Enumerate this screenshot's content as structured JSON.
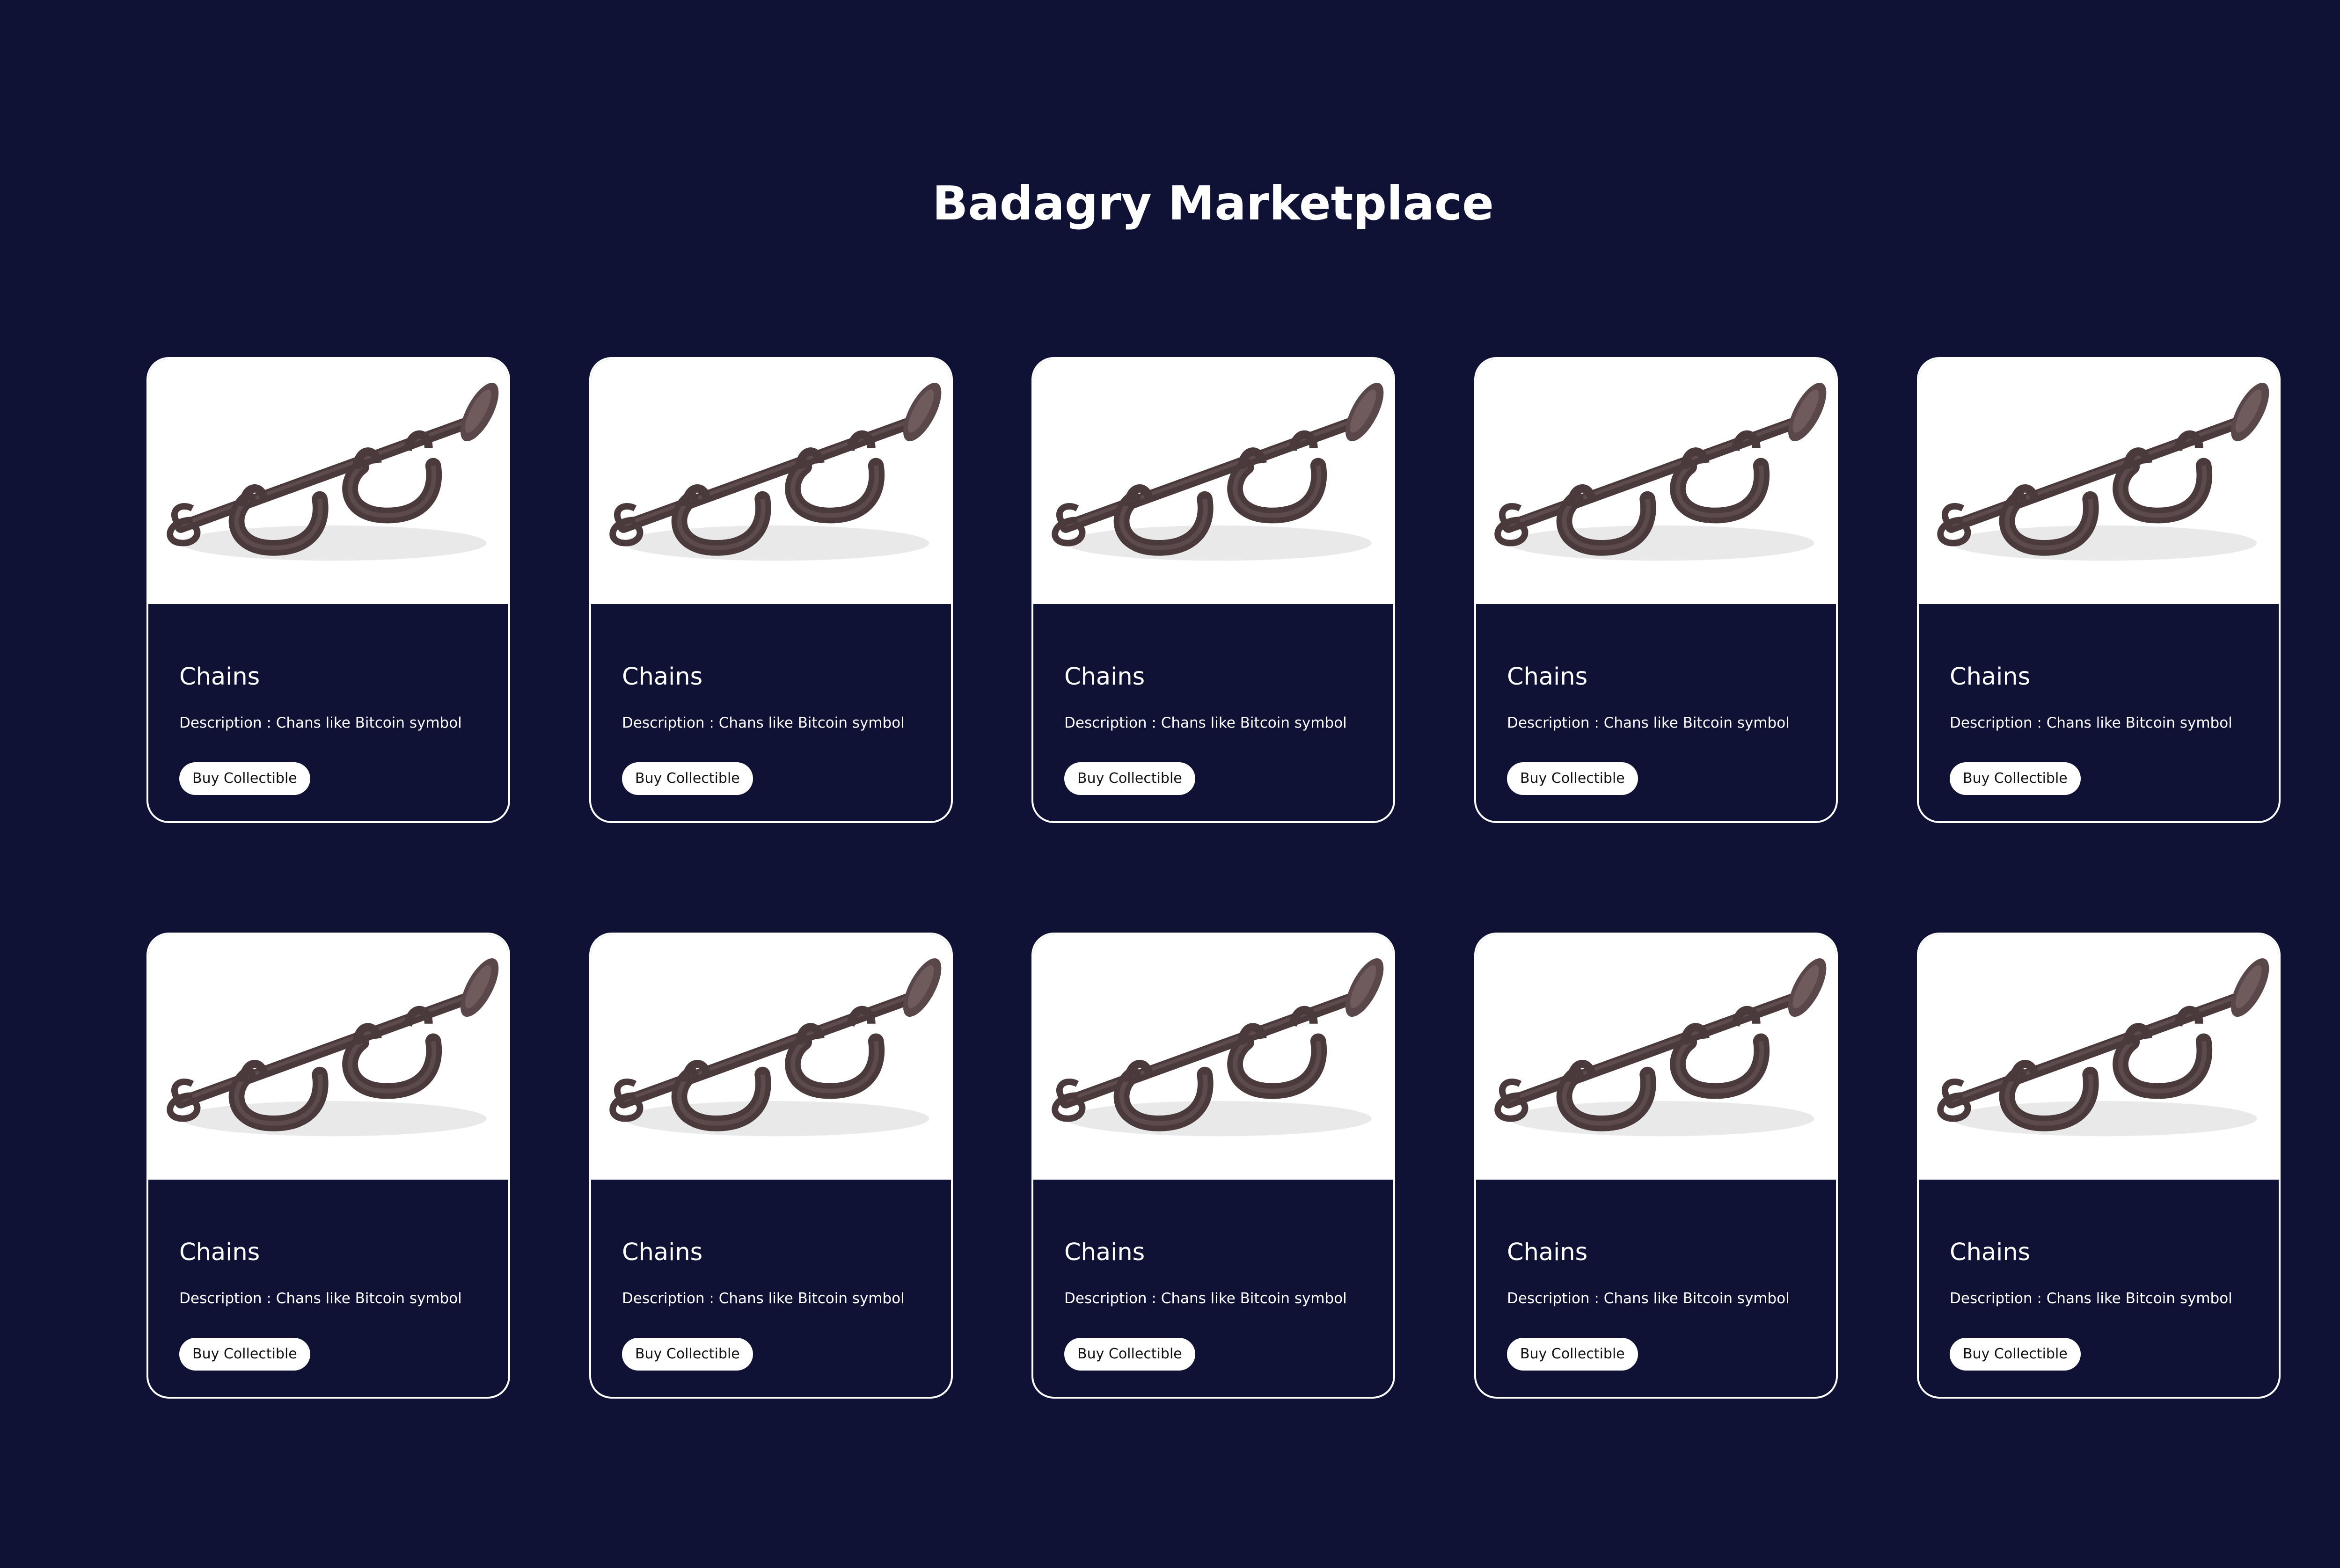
{
  "page": {
    "title": "Badagry Marketplace",
    "background_color": "#0f1234"
  },
  "collectibles": [
    {
      "name": "Chains",
      "description_label": "Description : ",
      "description": "Chans like Bitcoin symbol",
      "button_label": "Buy Collectible",
      "image_icon": "chains-image"
    },
    {
      "name": "Chains",
      "description_label": "Description : ",
      "description": "Chans like Bitcoin symbol",
      "button_label": "Buy Collectible",
      "image_icon": "chains-image"
    },
    {
      "name": "Chains",
      "description_label": "Description : ",
      "description": "Chans like Bitcoin symbol",
      "button_label": "Buy Collectible",
      "image_icon": "chains-image"
    },
    {
      "name": "Chains",
      "description_label": "Description : ",
      "description": "Chans like Bitcoin symbol",
      "button_label": "Buy Collectible",
      "image_icon": "chains-image"
    },
    {
      "name": "Chains",
      "description_label": "Description : ",
      "description": "Chans like Bitcoin symbol",
      "button_label": "Buy Collectible",
      "image_icon": "chains-image"
    },
    {
      "name": "Chains",
      "description_label": "Description : ",
      "description": "Chans like Bitcoin symbol",
      "button_label": "Buy Collectible",
      "image_icon": "chains-image"
    },
    {
      "name": "Chains",
      "description_label": "Description : ",
      "description": "Chans like Bitcoin symbol",
      "button_label": "Buy Collectible",
      "image_icon": "chains-image"
    },
    {
      "name": "Chains",
      "description_label": "Description : ",
      "description": "Chans like Bitcoin symbol",
      "button_label": "Buy Collectible",
      "image_icon": "chains-image"
    },
    {
      "name": "Chains",
      "description_label": "Description : ",
      "description": "Chans like Bitcoin symbol",
      "button_label": "Buy Collectible",
      "image_icon": "chains-image"
    },
    {
      "name": "Chains",
      "description_label": "Description : ",
      "description": "Chans like Bitcoin symbol",
      "button_label": "Buy Collectible",
      "image_icon": "chains-image"
    }
  ]
}
